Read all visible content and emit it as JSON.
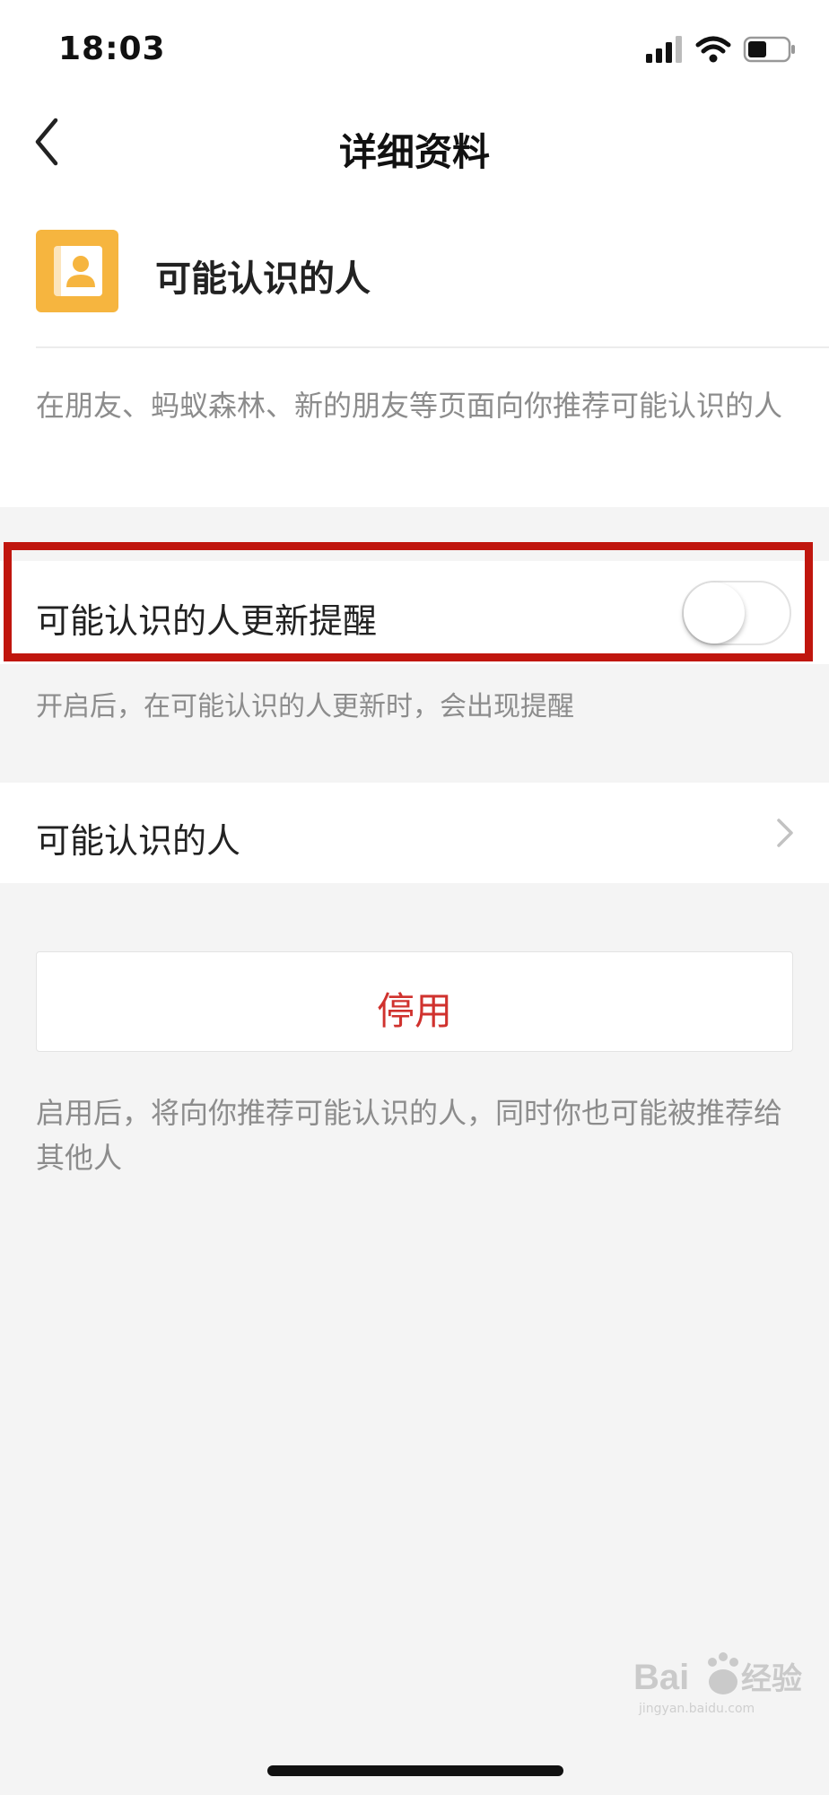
{
  "status_bar": {
    "time": "18:03",
    "icons": [
      "cellular-signal-icon",
      "wifi-icon",
      "battery-icon"
    ]
  },
  "nav": {
    "title": "详细资料",
    "back_icon": "chevron-left-icon"
  },
  "feature": {
    "icon": "contact-card-icon",
    "icon_color": "#f6b53f",
    "name": "可能认识的人",
    "description": "在朋友、蚂蚁森林、新的朋友等页面向你推荐可能认识的人"
  },
  "update_reminder": {
    "label": "可能认识的人更新提醒",
    "enabled": false,
    "hint": "开启后，在可能认识的人更新时，会出现提醒"
  },
  "link_row": {
    "label": "可能认识的人",
    "icon": "chevron-right-icon"
  },
  "action": {
    "label": "停用",
    "color": "#d0322e"
  },
  "bottom_hint": "启用后，将向你推荐可能认识的人，同时你也可能被推荐给其他人",
  "watermark": {
    "brand": "Baidu经验",
    "url": "jingyan.baidu.com"
  },
  "highlight_color": "#c0160e"
}
